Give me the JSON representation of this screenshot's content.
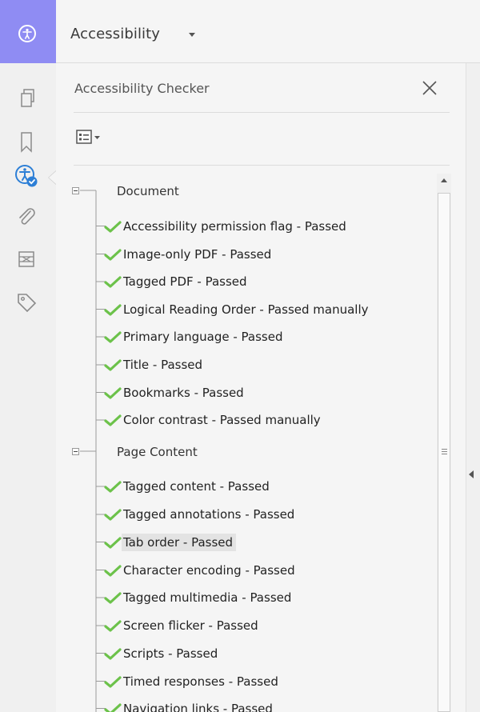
{
  "header": {
    "title": "Accessibility"
  },
  "panel": {
    "title": "Accessibility Checker",
    "groups": [
      {
        "label": "Document",
        "items": [
          "Accessibility permission flag - Passed",
          "Image-only PDF - Passed",
          "Tagged PDF - Passed",
          "Logical Reading Order - Passed manually",
          "Primary language - Passed",
          "Title - Passed",
          "Bookmarks - Passed",
          "Color contrast - Passed manually"
        ]
      },
      {
        "label": "Page Content",
        "items": [
          "Tagged content - Passed",
          "Tagged annotations - Passed",
          "Tab order - Passed",
          "Character encoding - Passed",
          "Tagged multimedia - Passed",
          "Screen flicker - Passed",
          "Scripts - Passed",
          "Timed responses - Passed",
          "Navigation links - Passed"
        ]
      }
    ]
  },
  "rail_icons": [
    "pages-icon",
    "bookmark-icon",
    "accessibility-check-icon",
    "attachment-icon",
    "layers-icon",
    "tags-icon"
  ],
  "colors": {
    "accent": "#8f8cf3",
    "check_green": "#6cc24a",
    "active_blue": "#2d7fd6"
  }
}
